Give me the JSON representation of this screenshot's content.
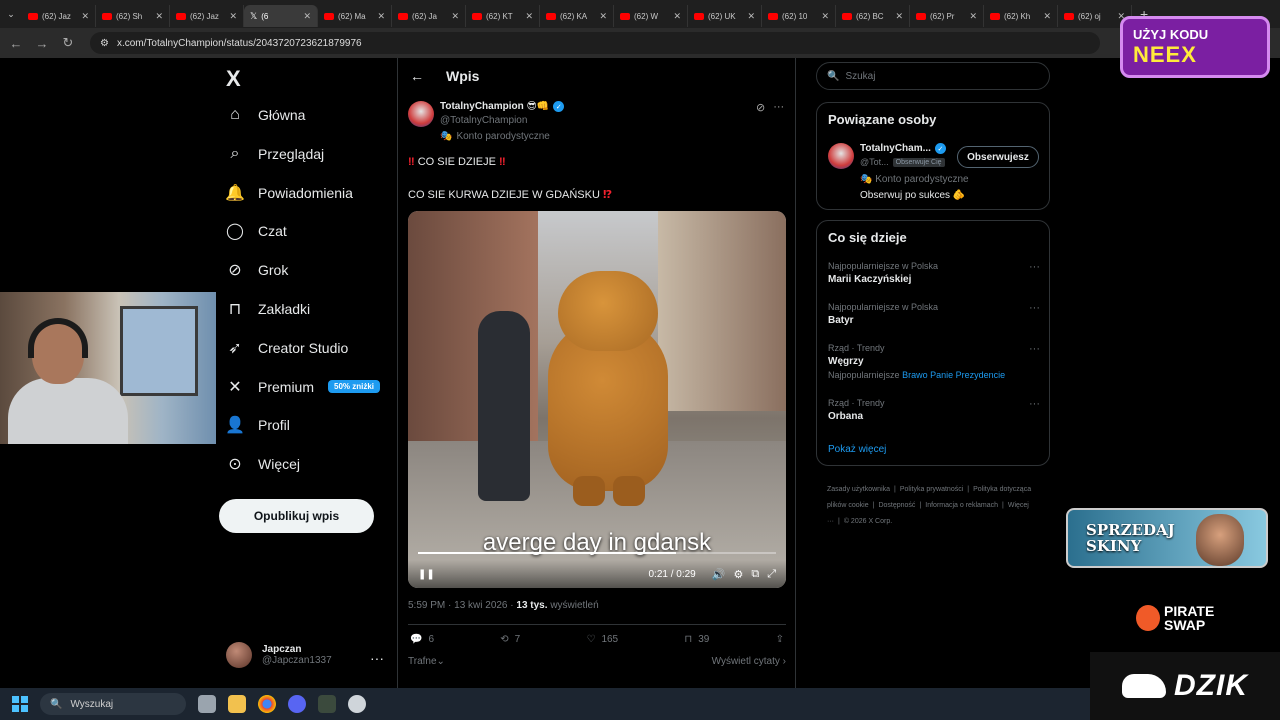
{
  "browser": {
    "tabs": [
      {
        "label": "(62) Jaz",
        "type": "youtube"
      },
      {
        "label": "(62) Sh",
        "type": "youtube"
      },
      {
        "label": "(62) Jaz",
        "type": "youtube"
      },
      {
        "label": "(6",
        "type": "x",
        "active": true
      },
      {
        "label": "(62) Ma",
        "type": "youtube"
      },
      {
        "label": "(62) Ja",
        "type": "youtube"
      },
      {
        "label": "(62) KT",
        "type": "youtube"
      },
      {
        "label": "(62) KA",
        "type": "youtube"
      },
      {
        "label": "(62) W",
        "type": "youtube"
      },
      {
        "label": "(62) UK",
        "type": "youtube"
      },
      {
        "label": "(62) 10",
        "type": "youtube"
      },
      {
        "label": "(62) BC",
        "type": "youtube"
      },
      {
        "label": "(62) Pr",
        "type": "youtube"
      },
      {
        "label": "(62) Kh",
        "type": "youtube"
      },
      {
        "label": "(62) oj",
        "type": "youtube"
      }
    ],
    "url": "x.com/TotalnyChampion/status/2043720723621879976",
    "new_tab": "+"
  },
  "promo_top": {
    "line1": "UŻYJ KODU",
    "line2": "NEEX"
  },
  "nav": {
    "logo": "X",
    "items": [
      {
        "label": "Główna",
        "icon": "home-icon"
      },
      {
        "label": "Przeglądaj",
        "icon": "search-icon"
      },
      {
        "label": "Powiadomienia",
        "icon": "bell-icon"
      },
      {
        "label": "Czat",
        "icon": "chat-icon"
      },
      {
        "label": "Grok",
        "icon": "grok-icon"
      },
      {
        "label": "Zakładki",
        "icon": "bookmark-icon"
      },
      {
        "label": "Creator Studio",
        "icon": "rocket-icon"
      },
      {
        "label": "Premium",
        "icon": "x-icon",
        "badge": "50% zniżki"
      },
      {
        "label": "Profil",
        "icon": "person-icon"
      },
      {
        "label": "Więcej",
        "icon": "more-circle-icon"
      }
    ],
    "post_button": "Opublikuj wpis",
    "account": {
      "name": "Japczan",
      "handle": "@Japczan1337"
    }
  },
  "main": {
    "header": "Wpis",
    "post": {
      "author": "TotalnyChampion 😎👊",
      "handle": "@TotalnyChampion",
      "parody_label": "Konto parodystyczne",
      "text1": "CO SIE DZIEJE",
      "text2": "CO SIE KURWA DZIEJE W GDAŃSKU",
      "video": {
        "caption": "averge day in gdansk",
        "time": "0:21 / 0:29",
        "progress": 0.72
      },
      "time": "5:59 PM · 13 kwi 2026 ·",
      "views_count": "13 tys.",
      "views_label": "wyświetleń",
      "replies": "6",
      "reposts": "7",
      "likes": "165",
      "bookmarks": "39",
      "sort_label": "Trafne",
      "quotes_link": "Wyświetl cytaty"
    }
  },
  "right": {
    "search_placeholder": "Szukaj",
    "related": {
      "title": "Powiązane osoby",
      "name": "TotalnyCham...",
      "handle": "@Tot...",
      "follows_you": "Obserwuje Cię",
      "follow_button": "Obserwujesz",
      "parody": "Konto parodystyczne",
      "bio": "Obserwuj po sukces 🫵"
    },
    "trends": {
      "title": "Co się dzieje",
      "items": [
        {
          "category": "Najpopularniejsze w Polska",
          "title": "Marii Kaczyńskiej"
        },
        {
          "category": "Najpopularniejsze w Polska",
          "title": "Batyr"
        },
        {
          "category": "Rząd · Trendy",
          "title": "Węgrzy",
          "sub_prefix": "Najpopularniejsze",
          "sub_link": "Brawo Panie Prezydencie"
        },
        {
          "category": "Rząd · Trendy",
          "title": "Orbana"
        }
      ],
      "show_more": "Pokaż więcej"
    },
    "footer": [
      "Zasady użytkownika",
      "Polityka prywatności",
      "Polityka dotycząca plików cookie",
      "Dostępność",
      "Informacja o reklamach",
      "Więcej ···",
      "© 2026 X Corp."
    ]
  },
  "overlays": {
    "skiny": "SPRZEDAJ SKINY",
    "pirate": "PIRATE SWAP",
    "dzik": "DZIK"
  },
  "taskbar": {
    "search_placeholder": "Wyszukaj"
  },
  "colors": {
    "accent": "#1d9bf0",
    "background": "#000000",
    "border": "#2f3336",
    "muted": "#71767b"
  }
}
